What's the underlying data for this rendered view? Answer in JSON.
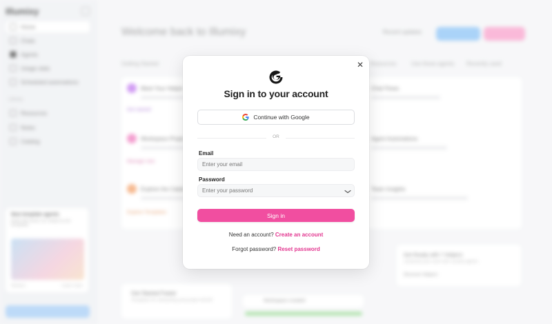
{
  "background": {
    "app_name": "Illumixy",
    "sidebar": {
      "items": [
        "Home",
        "Chats",
        "Agents",
        "Usage stats",
        "Scheduled automations"
      ],
      "section_label": "Library",
      "section_items": [
        "Resources",
        "Notes",
        "Catalog"
      ],
      "promo": {
        "title": "New template agents",
        "text": "Build with these six ready-to-use templates",
        "footer_left": "Dismiss",
        "footer_right": "Learn more"
      }
    },
    "header": {
      "title": "Welcome back to Illumixy",
      "link": "Recent updates"
    },
    "tabs": [
      "Getting Started",
      "Resources",
      "Use these agents",
      "Recently used"
    ],
    "cards": [
      {
        "title": "Meet Your Helper",
        "link": "Get started",
        "color": "#c27cf0"
      },
      {
        "title": "Workspace Projects",
        "link": "Manage now",
        "color": "#f07fc0"
      },
      {
        "title": "Explore the Catalog",
        "link": "Explore Templates",
        "color": "#f4a36c"
      }
    ],
    "right_cards": [
      "Chat Flows",
      "Agent Automations",
      "Team Insights"
    ],
    "bottom_card": {
      "title": "Get Started Faster",
      "text": "Templates for onboarding and project kickoff"
    },
    "bottom_right_card": {
      "title": "Get Ready with 7 Helpers",
      "text": "Jumpstart your work with curated agents",
      "link": "Discover Helpers"
    },
    "bottom_task": "Workspace created"
  },
  "modal": {
    "title": "Sign in to your account",
    "google_button": "Continue with Google",
    "divider": "OR",
    "email_label": "Email",
    "email_placeholder": "Enter your email",
    "email_value": "",
    "password_label": "Password",
    "password_placeholder": "Enter your password",
    "password_value": "",
    "submit": "Sign in",
    "need_account_text": "Need an account?",
    "create_link": "Create an account",
    "forgot_text": "Forgot password?",
    "reset_link": "Reset password",
    "accent_color": "#f14ea0",
    "link_color": "#e2358f"
  }
}
